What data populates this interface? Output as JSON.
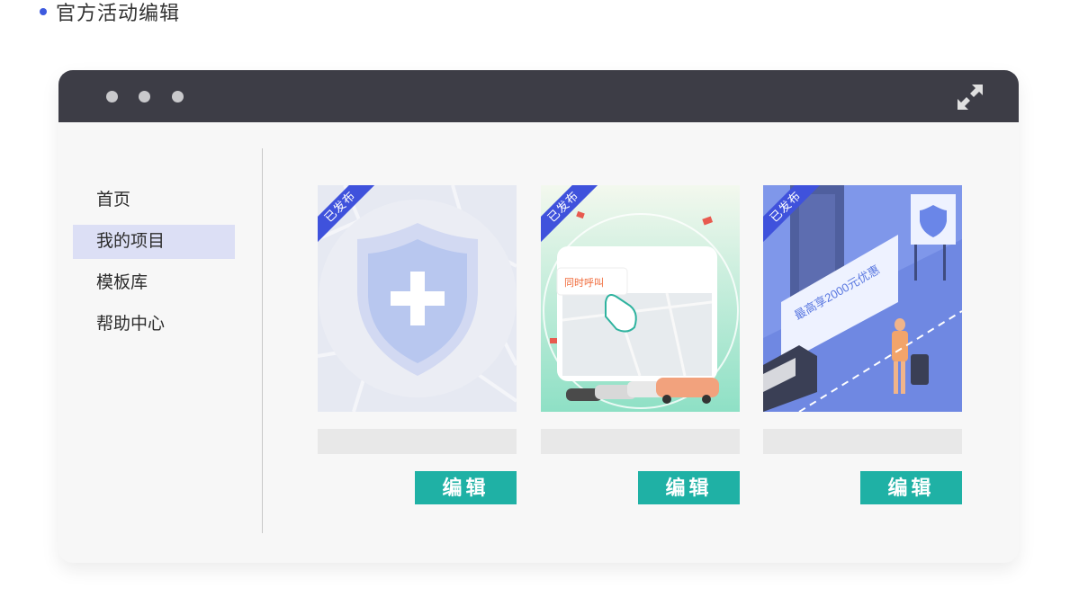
{
  "page": {
    "heading": "官方活动编辑"
  },
  "sidebar": {
    "items": [
      {
        "label": "首页",
        "active": false
      },
      {
        "label": "我的项目",
        "active": true
      },
      {
        "label": "模板库",
        "active": false
      },
      {
        "label": "帮助中心",
        "active": false
      }
    ]
  },
  "cards": [
    {
      "status_badge": "已发布",
      "edit_label": "编辑",
      "title": ""
    },
    {
      "status_badge": "已发布",
      "edit_label": "编辑",
      "title": "",
      "thumb_text": "同时呼叫"
    },
    {
      "status_badge": "已发布",
      "edit_label": "编辑",
      "title": "",
      "thumb_text": "最高享2000元优惠"
    }
  ],
  "colors": {
    "accent": "#3d5adf",
    "edit_button": "#1fb1a5",
    "titlebar": "#3d3d46",
    "active_item": "#dcdff5"
  },
  "icons": {
    "window_controls": "traffic-dots",
    "expand": "expand-icon"
  }
}
